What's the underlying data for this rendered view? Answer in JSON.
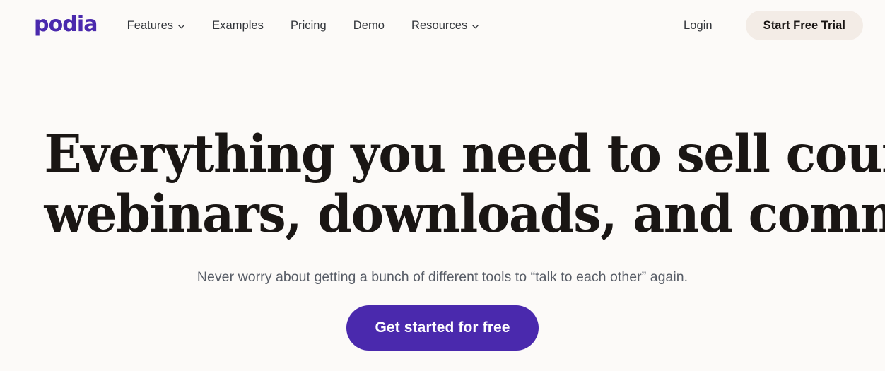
{
  "theme": {
    "page_background": "#fcfaf8",
    "brand_purple": "#4a29ad",
    "text_dark": "#1a1614",
    "nav_text": "#33363b",
    "subtitle_text": "#575c66",
    "trial_button_background": "#f3ece6",
    "cta_text": "#ffffff"
  },
  "header": {
    "logo_text": "podia",
    "nav_items": [
      {
        "label": "Features",
        "has_dropdown": true,
        "icon": "chevron-down-icon"
      },
      {
        "label": "Examples",
        "has_dropdown": false,
        "icon": ""
      },
      {
        "label": "Pricing",
        "has_dropdown": false,
        "icon": ""
      },
      {
        "label": "Demo",
        "has_dropdown": false,
        "icon": ""
      },
      {
        "label": "Resources",
        "has_dropdown": true,
        "icon": "chevron-down-icon"
      }
    ],
    "login_label": "Login",
    "trial_button_label": "Start Free Trial"
  },
  "hero": {
    "title_line_1": "Everything you need to sell courses,",
    "title_line_2": "webinars, downloads, and community.",
    "subtitle": "Never worry about getting a bunch of different tools to “talk to each other” again.",
    "cta_label": "Get started for free"
  }
}
